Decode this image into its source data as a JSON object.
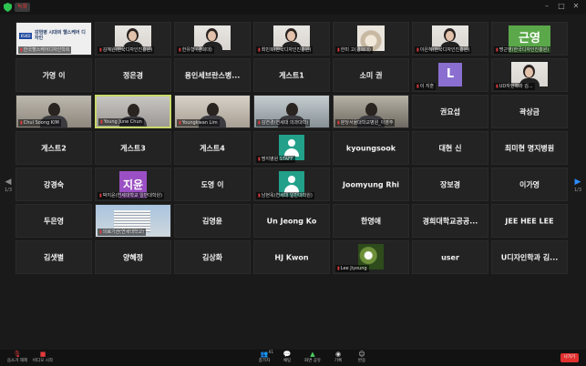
{
  "window": {
    "rec_label": "녹화"
  },
  "gallery": {
    "page_left": "1/3",
    "page_right": "1/3",
    "tiles": [
      {
        "type": "slide",
        "slide_logo": "KSKD",
        "slide_title": "감염병 시대의 헬스케어 디자인",
        "label": "한국헬스케어디자인학회"
      },
      {
        "type": "portrait",
        "label": "김혜원(한국디자인진흥원)"
      },
      {
        "type": "portrait",
        "label": "한유형 (경희대)"
      },
      {
        "type": "portrait",
        "label": "최민희(한국디자인진흥원)"
      },
      {
        "type": "portrait-cat",
        "label": "한미 고(경희대)"
      },
      {
        "type": "portrait",
        "label": "이은혜(한국디자인진흥원)"
      },
      {
        "type": "initial",
        "initial": "근영",
        "color": "#5aa84a",
        "label": "명근영(한국디자인진흥원)"
      },
      {
        "type": "name",
        "name": "가영 이"
      },
      {
        "type": "name",
        "name": "정은경"
      },
      {
        "type": "name",
        "name": "용인세브란스병..."
      },
      {
        "type": "name",
        "name": "게스트1"
      },
      {
        "type": "name",
        "name": "소미 권"
      },
      {
        "type": "initial-small",
        "initial": "L",
        "color": "#8a6fd0",
        "label": "이 지훈"
      },
      {
        "type": "portrait",
        "label": "UD자인학과 김..."
      },
      {
        "type": "video",
        "label": "Chul Soong KIM"
      },
      {
        "type": "video",
        "active": true,
        "label": "Young June Chun"
      },
      {
        "type": "video",
        "label": "Youngkwan Lim"
      },
      {
        "type": "video",
        "label": "김연경(연세대 의과대학)"
      },
      {
        "type": "video",
        "label": "분당서울대학교병원_이영주"
      },
      {
        "type": "name",
        "name": "권요섭"
      },
      {
        "type": "name",
        "name": "곽상금"
      },
      {
        "type": "name",
        "name": "게스트2"
      },
      {
        "type": "name",
        "name": "게스트3"
      },
      {
        "type": "name",
        "name": "게스트4"
      },
      {
        "type": "generic",
        "label": "명지병원 STAFF"
      },
      {
        "type": "name",
        "name": "kyoungsook"
      },
      {
        "type": "name",
        "name": "대현 신"
      },
      {
        "type": "name",
        "name": "최미현 명지병원"
      },
      {
        "type": "name",
        "name": "강경숙"
      },
      {
        "type": "initial",
        "initial": "지윤",
        "color": "#9b4fc4",
        "label": "박지윤(연세대학교 일반대학원)"
      },
      {
        "type": "name",
        "name": "도영 이"
      },
      {
        "type": "generic",
        "label": "남현옥(연세대 일반대학원)"
      },
      {
        "type": "name",
        "name": "Joomyung Rhi"
      },
      {
        "type": "name",
        "name": "장보경"
      },
      {
        "type": "name",
        "name": "이가영"
      },
      {
        "type": "name",
        "name": "두은영"
      },
      {
        "type": "building",
        "label": "의료기관(연세대학교)"
      },
      {
        "type": "name",
        "name": "김영윤"
      },
      {
        "type": "name",
        "name": "Un Jeong Ko"
      },
      {
        "type": "name",
        "name": "한영애"
      },
      {
        "type": "name",
        "name": "경희대학교공공..."
      },
      {
        "type": "name",
        "name": "JEE HEE LEE"
      },
      {
        "type": "name",
        "name": "김샛별"
      },
      {
        "type": "name",
        "name": "양혜정"
      },
      {
        "type": "name",
        "name": "김상화"
      },
      {
        "type": "name",
        "name": "HJ Kwon"
      },
      {
        "type": "flower",
        "label": "Lee Jiyoung"
      },
      {
        "type": "name",
        "name": "user"
      },
      {
        "type": "name",
        "name": "U디자인학과 김..."
      }
    ]
  },
  "toolbar": {
    "mute_label": "음소거 해제",
    "video_label": "비디오 시작",
    "participants_label": "참가자",
    "participants_count": "61",
    "chat_label": "채팅",
    "share_label": "화면 공유",
    "record_label": "기록",
    "reactions_label": "반응",
    "end_label": "나가기",
    "accent_red": "#e0312f",
    "accent_green": "#4cd263"
  }
}
